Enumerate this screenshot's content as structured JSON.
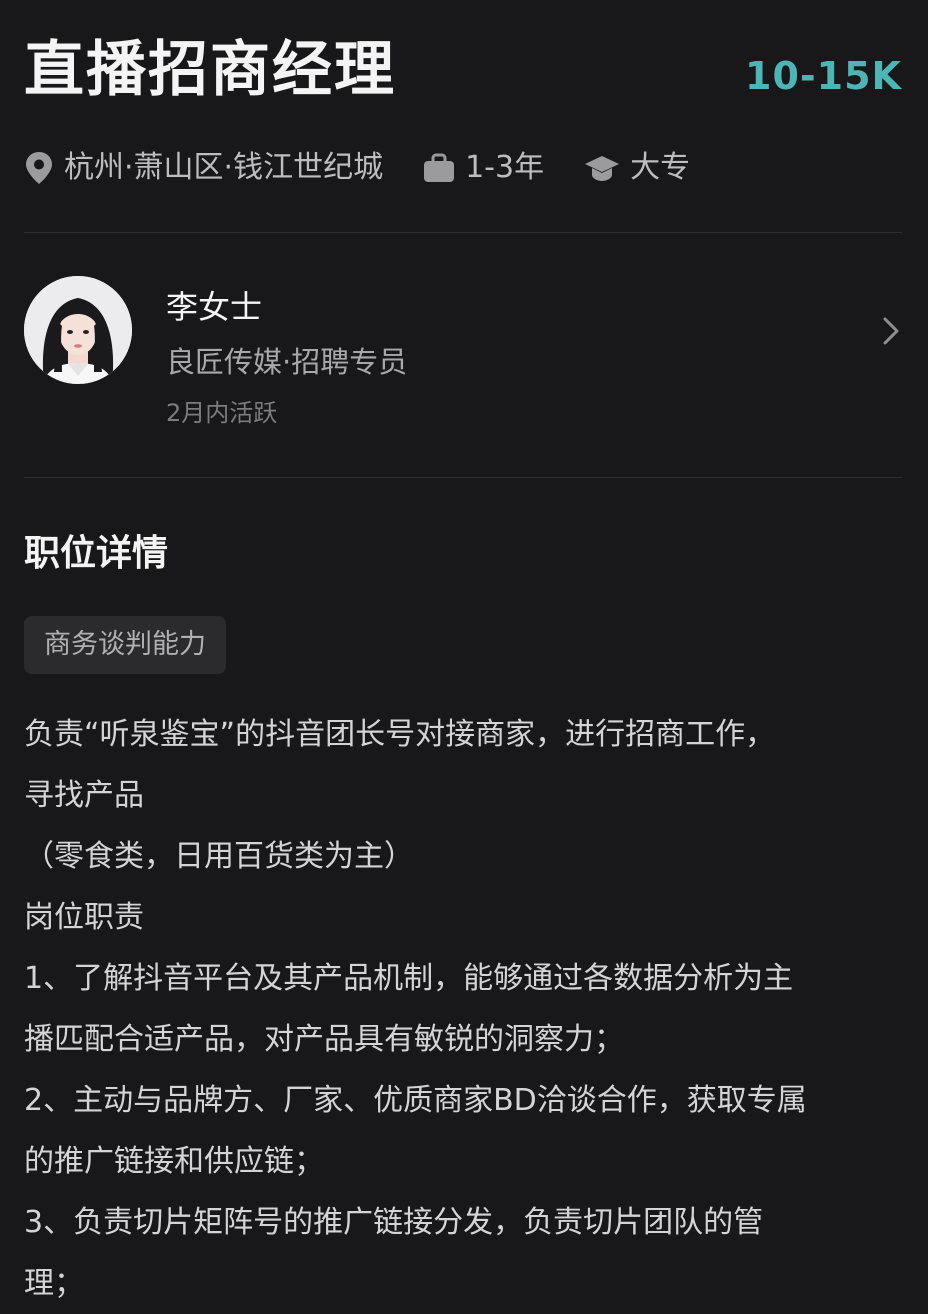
{
  "job": {
    "title": "直播招商经理",
    "salary": "10-15K",
    "location": "杭州·萧山区·钱江世纪城",
    "experience": "1-3年",
    "education": "大专"
  },
  "recruiter": {
    "name": "李女士",
    "company_role": "良匠传媒·招聘专员",
    "active_status": "2月内活跃"
  },
  "details": {
    "section_title": "职位详情",
    "tags": [
      "商务谈判能力"
    ],
    "description_lines": [
      "负责“听泉鉴宝”的抖音团长号对接商家，进行招商工作，",
      "寻找产品",
      "（零食类，日用百货类为主）",
      "岗位职责",
      "1、了解抖音平台及其产品机制，能够通过各数据分析为主",
      "播匹配合适产品，对产品具有敏锐的洞察力；",
      "2、主动与品牌方、厂家、优质商家BD洽谈合作，获取专属",
      "的推广链接和供应链；",
      "3、负责切片矩阵号的推广链接分发，负责切片团队的管",
      "理；"
    ]
  },
  "colors": {
    "background": "#18181a",
    "salary_accent": "#4fb4b6",
    "primary_text": "#f4f4f4",
    "secondary_text": "#bdbdbf"
  },
  "icons": {
    "location": "location-pin-icon",
    "experience": "briefcase-icon",
    "education": "graduation-cap-icon",
    "navigate": "chevron-right-icon"
  }
}
